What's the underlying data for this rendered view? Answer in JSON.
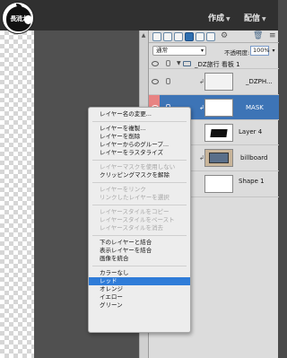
{
  "logo": {
    "text": "長消太"
  },
  "menubar": [
    {
      "label": "作成"
    },
    {
      "label": "配信"
    }
  ],
  "layers_panel": {
    "blend_mode": "通常",
    "opacity_label": "不透明度:",
    "opacity_value": "100%",
    "layers": [
      {
        "name": "_DZ旅行 看板 1",
        "type": "group"
      },
      {
        "name": "_DZPH...",
        "type": "layer"
      },
      {
        "name": "MASK",
        "type": "layer",
        "selected": true
      },
      {
        "name": "Layer 4",
        "type": "layer"
      },
      {
        "name": "billboard",
        "type": "layer"
      },
      {
        "name": "Shape 1",
        "type": "layer"
      }
    ]
  },
  "context_menu": {
    "items": [
      {
        "label": "レイヤー名の変更...",
        "enabled": true
      },
      {
        "label": "レイヤーを複製...",
        "enabled": true
      },
      {
        "label": "レイヤーを削除",
        "enabled": true
      },
      {
        "label": "レイヤーからのグループ...",
        "enabled": true
      },
      {
        "label": "レイヤーをラスタライズ",
        "enabled": true
      },
      {
        "label": "レイヤーマスクを使用しない",
        "enabled": false
      },
      {
        "label": "クリッピングマスクを解除",
        "enabled": true
      },
      {
        "label": "レイヤーをリンク",
        "enabled": false
      },
      {
        "label": "リンクしたレイヤーを選択",
        "enabled": false
      },
      {
        "label": "レイヤースタイルをコピー",
        "enabled": false
      },
      {
        "label": "レイヤースタイルをペースト",
        "enabled": false
      },
      {
        "label": "レイヤースタイルを消去",
        "enabled": false
      },
      {
        "label": "下のレイヤーと結合",
        "enabled": true
      },
      {
        "label": "表示レイヤーを結合",
        "enabled": true
      },
      {
        "label": "画像を統合",
        "enabled": true
      },
      {
        "label": "カラーなし",
        "enabled": true
      },
      {
        "label": "レッド",
        "enabled": true,
        "highlighted": true
      },
      {
        "label": "オレンジ",
        "enabled": true
      },
      {
        "label": "イエロー",
        "enabled": true
      },
      {
        "label": "グリーン",
        "enabled": true
      }
    ]
  },
  "colors": {
    "highlight": "#2f7cd8",
    "selected_layer": "#3d74b6",
    "red_label": "#e88383"
  },
  "icons": [
    "apple-logo-icon",
    "eye-icon",
    "chain-icon",
    "folder-icon",
    "trash-icon",
    "panel-menu-icon",
    "link-icon"
  ]
}
